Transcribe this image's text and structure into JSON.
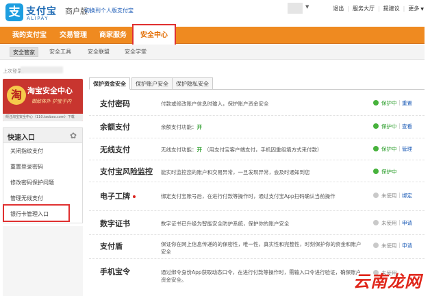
{
  "header": {
    "logo_cn": "支付宝",
    "logo_en": "ALIPAY",
    "edition": "商户版",
    "switch_link": "切换到个人版支付宝",
    "links": [
      "退出",
      "服务大厅",
      "提建议",
      "更多"
    ]
  },
  "main_nav": {
    "items": [
      "我的支付宝",
      "交易管理",
      "商家服务",
      "安全中心"
    ],
    "active": "安全中心"
  },
  "sub_nav": {
    "items": [
      "安全管家",
      "安全工具",
      "安全联盟",
      "安全学堂"
    ],
    "active": "安全管家"
  },
  "last_login_label": "上次登录：",
  "banner": {
    "title": "淘宝安全中心",
    "slogan": "御敌体外 护宝于内",
    "footer": "倾注淘宝安全中心（110.taobao.com）下载",
    "seal": "淘"
  },
  "quick_entry": {
    "title": "快速入口",
    "items": [
      "关闭指纹支付",
      "重置登录密码",
      "修改密码保护问题",
      "管理无线支付",
      "银行卡管理入口"
    ]
  },
  "tabs": [
    "保护资金安全",
    "保护账户安全",
    "保护隐私安全"
  ],
  "rows": [
    {
      "name": "支付密码",
      "desc": "付款或修改账户信息时输入，保护账户资金安全",
      "status": "保护中",
      "actions": [
        "重置"
      ]
    },
    {
      "name": "余额支付",
      "desc": "余额支付功能：",
      "desc_value": "开",
      "status": "保护中",
      "actions": [
        "查看"
      ]
    },
    {
      "name": "无线支付",
      "desc": "无线支付功能：",
      "desc_value": "开",
      "desc_extra": "（用支付宝客户端支付，手机因重组填方式来付款）",
      "status": "保护中",
      "actions": [
        "管理"
      ]
    },
    {
      "name": "支付宝风险监控",
      "desc": "能实时监控您的账户和交易异常，一旦发现异常，会及时通知到您",
      "status": "保护中",
      "actions": []
    },
    {
      "name": "电子工牌",
      "desc": "绑定支付宝账号后，在进行付款等操作时，通过支付宝App扫码确认当前操作",
      "status": "未使用",
      "actions": [
        "绑定"
      ]
    },
    {
      "name": "数字证书",
      "desc": "数字证书已升级为智能安全防护系统，保护你的账户安全",
      "status": "未使用",
      "actions": [
        "申请"
      ]
    },
    {
      "name": "支付盾",
      "desc": "保证你在网上信息传递的的保密性，唯一性，真实性和完整性，时刻保护你的资金和账户",
      "desc_line2": "安全",
      "status": "未使用",
      "actions": [
        "申请"
      ]
    },
    {
      "name": "手机宝令",
      "desc": "通过绑令身份App获取动态口令，在进行付款等操作时，需输入口令进行验证，确保账户",
      "desc_line2": "资金安全。",
      "status": "未使用",
      "actions": []
    }
  ],
  "watermark": "云南龙网",
  "colors": {
    "nav_orange": "#ef8a20",
    "active_orange_text": "#e26c00",
    "highlight_red": "#e03030",
    "status_green": "#47b23c",
    "status_gray": "#c9c9c9",
    "link_blue": "#1a5ab6"
  }
}
